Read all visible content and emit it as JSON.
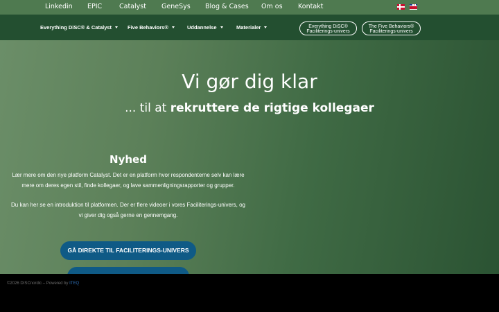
{
  "topbar": {
    "links": [
      "Linkedin",
      "EPIC",
      "Catalyst",
      "GeneSys",
      "Blog & Cases",
      "Om os",
      "Kontakt"
    ],
    "flags": [
      "danish-flag-icon",
      "uk-flag-icon"
    ]
  },
  "mainnav": {
    "items": [
      "Everything DiSC® & Catalyst",
      "Five Behaviors®",
      "Uddannelse",
      "Materialer"
    ],
    "pills": [
      {
        "line1": "Everything DiSC®",
        "line2": "Faciliterings-univers"
      },
      {
        "line1": "The Five Behaviors®",
        "line2": "Faciliterings-univers"
      }
    ]
  },
  "hero": {
    "title": "Vi gør dig klar",
    "subtitle_prefix": "... til at ",
    "subtitle_strong": "rekruttere de rigtige kollegaer"
  },
  "news": {
    "heading": "Nyhed",
    "paragraph1": "Lær mere om den nye platform Catalyst. Det er en platform hvor respondenterne selv kan lære mere om deres egen stil, finde kollegaer, og lave sammenligningsrapporter og grupper.",
    "paragraph2": "Du kan her se en introduktion til platformen. Der er flere videoer i vores Faciliterings-univers, og vi giver dig også gerne en gennemgang.",
    "button_label": "GÅ DIREKTE TIL FACILITERINGS-UNIVERS"
  },
  "footer": {
    "copyright": "©2026 DISCnordic – Powered by ",
    "brand": "ITEQ"
  },
  "colors": {
    "topbar": "#4f7a50",
    "mainnav": "#234f30",
    "button": "#0f5a86"
  }
}
